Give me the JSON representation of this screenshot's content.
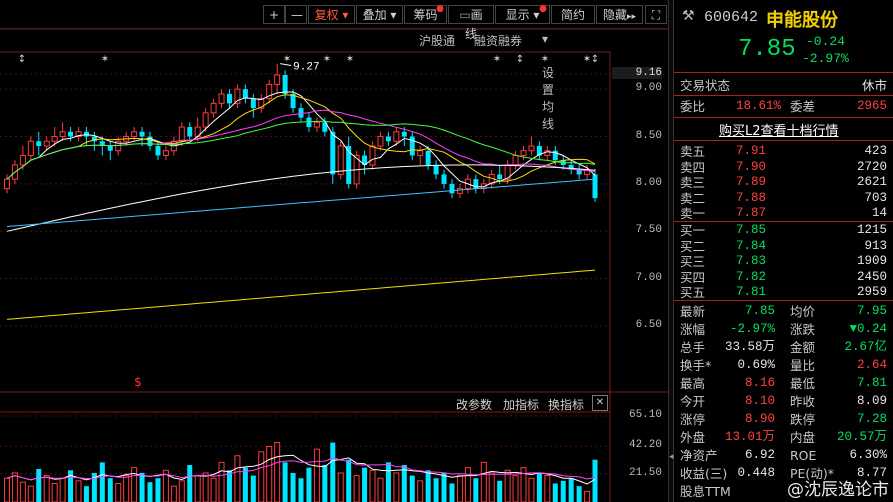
{
  "toolbar": {
    "plus": "+",
    "minus": "—",
    "fuquan": "复权",
    "diejia": "叠加",
    "chouma": "筹码",
    "huaxian": "画线",
    "xianshi": "显示",
    "jianyue": "简约",
    "yincang": "隐藏",
    "next": "▸▸",
    "fullscreen": "⛶"
  },
  "subbar": {
    "hgt": "沪股通",
    "rzrq": "融资融券",
    "shezhi": "设置均线"
  },
  "chart_data": {
    "type": "candlestick",
    "price_axis_ticks": [
      "9.16",
      "9.00",
      "8.50",
      "8.00",
      "7.50",
      "7.00",
      "6.50"
    ],
    "volume_axis_ticks": [
      "65.10",
      "42.20",
      "21.50"
    ],
    "high_label": "9.27",
    "dollar_marker": "$",
    "candles": [
      [
        7.95,
        8.05,
        7.9,
        8.1
      ],
      [
        8.05,
        8.2,
        8.0,
        8.25
      ],
      [
        8.2,
        8.3,
        8.15,
        8.4
      ],
      [
        8.3,
        8.45,
        8.25,
        8.5
      ],
      [
        8.45,
        8.4,
        8.3,
        8.55
      ],
      [
        8.4,
        8.45,
        8.35,
        8.5
      ],
      [
        8.45,
        8.5,
        8.4,
        8.6
      ],
      [
        8.5,
        8.55,
        8.45,
        8.65
      ],
      [
        8.55,
        8.5,
        8.45,
        8.6
      ],
      [
        8.5,
        8.55,
        8.45,
        8.6
      ],
      [
        8.55,
        8.5,
        8.4,
        8.6
      ],
      [
        8.5,
        8.45,
        8.35,
        8.55
      ],
      [
        8.45,
        8.4,
        8.3,
        8.5
      ],
      [
        8.4,
        8.35,
        8.25,
        8.45
      ],
      [
        8.35,
        8.45,
        8.3,
        8.5
      ],
      [
        8.45,
        8.5,
        8.4,
        8.55
      ],
      [
        8.5,
        8.55,
        8.45,
        8.6
      ],
      [
        8.55,
        8.5,
        8.4,
        8.6
      ],
      [
        8.5,
        8.4,
        8.35,
        8.55
      ],
      [
        8.4,
        8.3,
        8.25,
        8.45
      ],
      [
        8.3,
        8.35,
        8.25,
        8.4
      ],
      [
        8.35,
        8.45,
        8.3,
        8.5
      ],
      [
        8.45,
        8.6,
        8.4,
        8.65
      ],
      [
        8.6,
        8.5,
        8.45,
        8.65
      ],
      [
        8.5,
        8.6,
        8.45,
        8.7
      ],
      [
        8.6,
        8.75,
        8.55,
        8.8
      ],
      [
        8.75,
        8.85,
        8.7,
        8.9
      ],
      [
        8.85,
        8.95,
        8.8,
        9.0
      ],
      [
        8.95,
        8.85,
        8.8,
        9.0
      ],
      [
        8.85,
        9.0,
        8.8,
        9.05
      ],
      [
        9.0,
        8.9,
        8.85,
        9.05
      ],
      [
        8.9,
        8.8,
        8.7,
        8.95
      ],
      [
        8.8,
        8.9,
        8.75,
        8.95
      ],
      [
        8.9,
        9.05,
        8.85,
        9.1
      ],
      [
        9.05,
        9.15,
        8.95,
        9.27
      ],
      [
        9.15,
        8.95,
        8.9,
        9.2
      ],
      [
        8.95,
        8.8,
        8.75,
        9.0
      ],
      [
        8.8,
        8.7,
        8.65,
        8.85
      ],
      [
        8.7,
        8.6,
        8.55,
        8.75
      ],
      [
        8.6,
        8.65,
        8.55,
        8.7
      ],
      [
        8.65,
        8.55,
        8.5,
        8.7
      ],
      [
        8.55,
        8.1,
        8.0,
        8.6
      ],
      [
        8.1,
        8.4,
        8.05,
        8.45
      ],
      [
        8.4,
        8.0,
        7.95,
        8.5
      ],
      [
        8.0,
        8.3,
        7.95,
        8.35
      ],
      [
        8.3,
        8.2,
        8.1,
        8.35
      ],
      [
        8.2,
        8.4,
        8.15,
        8.45
      ],
      [
        8.4,
        8.5,
        8.35,
        8.55
      ],
      [
        8.5,
        8.45,
        8.4,
        8.55
      ],
      [
        8.45,
        8.55,
        8.4,
        8.6
      ],
      [
        8.55,
        8.5,
        8.4,
        8.6
      ],
      [
        8.5,
        8.3,
        8.25,
        8.55
      ],
      [
        8.3,
        8.35,
        8.2,
        8.4
      ],
      [
        8.35,
        8.2,
        8.15,
        8.4
      ],
      [
        8.2,
        8.1,
        8.05,
        8.25
      ],
      [
        8.1,
        8.0,
        7.95,
        8.15
      ],
      [
        8.0,
        7.9,
        7.85,
        8.05
      ],
      [
        7.9,
        7.95,
        7.85,
        8.0
      ],
      [
        7.95,
        8.05,
        7.9,
        8.1
      ],
      [
        8.05,
        7.95,
        7.9,
        8.1
      ],
      [
        7.95,
        8.0,
        7.9,
        8.05
      ],
      [
        8.0,
        8.1,
        7.95,
        8.15
      ],
      [
        8.1,
        8.05,
        8.0,
        8.2
      ],
      [
        8.05,
        8.2,
        8.0,
        8.25
      ],
      [
        8.2,
        8.3,
        8.15,
        8.35
      ],
      [
        8.3,
        8.35,
        8.25,
        8.4
      ],
      [
        8.35,
        8.4,
        8.3,
        8.5
      ],
      [
        8.4,
        8.3,
        8.25,
        8.45
      ],
      [
        8.3,
        8.35,
        8.25,
        8.4
      ],
      [
        8.35,
        8.25,
        8.2,
        8.4
      ],
      [
        8.25,
        8.2,
        8.15,
        8.3
      ],
      [
        8.2,
        8.15,
        8.1,
        8.25
      ],
      [
        8.15,
        8.1,
        8.05,
        8.2
      ],
      [
        8.1,
        8.15,
        8.05,
        8.2
      ],
      [
        8.1,
        7.85,
        7.81,
        8.16
      ]
    ],
    "volumes": [
      18,
      22,
      15,
      12,
      25,
      20,
      14,
      18,
      24,
      16,
      12,
      22,
      30,
      18,
      14,
      20,
      26,
      22,
      15,
      18,
      24,
      12,
      16,
      28,
      20,
      22,
      18,
      30,
      24,
      35,
      26,
      20,
      38,
      42,
      45,
      30,
      22,
      18,
      26,
      40,
      28,
      45,
      22,
      32,
      20,
      26,
      24,
      18,
      30,
      22,
      28,
      20,
      16,
      24,
      18,
      22,
      14,
      20,
      26,
      18,
      30,
      22,
      16,
      24,
      20,
      26,
      18,
      22,
      20,
      14,
      16,
      18,
      12,
      8,
      32
    ]
  },
  "stock": {
    "code": "600642",
    "name": "申能股份",
    "price": "7.85",
    "change": "-0.24",
    "change_pct": "-2.97%"
  },
  "panel": {
    "status_label": "交易状态",
    "status_value": "休市",
    "weibi_label": "委比",
    "weibi_value": "18.61%",
    "weicha_label": "委差",
    "weicha_value": "2965",
    "l2_link": "购买L2查看十档行情",
    "asks": [
      {
        "label": "卖五",
        "price": "7.91",
        "vol": "423"
      },
      {
        "label": "卖四",
        "price": "7.90",
        "vol": "2720"
      },
      {
        "label": "卖三",
        "price": "7.89",
        "vol": "2621"
      },
      {
        "label": "卖二",
        "price": "7.88",
        "vol": "703"
      },
      {
        "label": "卖一",
        "price": "7.87",
        "vol": "14"
      }
    ],
    "bids": [
      {
        "label": "买一",
        "price": "7.85",
        "vol": "1215"
      },
      {
        "label": "买二",
        "price": "7.84",
        "vol": "913"
      },
      {
        "label": "买三",
        "price": "7.83",
        "vol": "1909"
      },
      {
        "label": "买四",
        "price": "7.82",
        "vol": "2450"
      },
      {
        "label": "买五",
        "price": "7.81",
        "vol": "2959"
      }
    ],
    "stats": [
      {
        "l1": "最新",
        "v1": "7.85",
        "c1": "green",
        "l2": "均价",
        "v2": "7.95",
        "c2": "green"
      },
      {
        "l1": "涨幅",
        "v1": "-2.97%",
        "c1": "green",
        "l2": "涨跌",
        "v2": "▼0.24",
        "c2": "green"
      },
      {
        "l1": "总手",
        "v1": "33.58万",
        "c1": "white",
        "l2": "金额",
        "v2": "2.67亿",
        "c2": "green"
      },
      {
        "l1": "换手*",
        "v1": "0.69%",
        "c1": "white",
        "l2": "量比",
        "v2": "2.64",
        "c2": "red"
      },
      {
        "l1": "最高",
        "v1": "8.16",
        "c1": "red",
        "l2": "最低",
        "v2": "7.81",
        "c2": "green"
      },
      {
        "l1": "今开",
        "v1": "8.10",
        "c1": "red",
        "l2": "昨收",
        "v2": "8.09",
        "c2": "white"
      },
      {
        "l1": "涨停",
        "v1": "8.90",
        "c1": "red",
        "l2": "跌停",
        "v2": "7.28",
        "c2": "green"
      },
      {
        "l1": "外盘",
        "v1": "13.01万",
        "c1": "red",
        "l2": "内盘",
        "v2": "20.57万",
        "c2": "green"
      },
      {
        "l1": "净资产",
        "v1": "6.92",
        "c1": "white",
        "l2": "ROE",
        "v2": "6.30%",
        "c2": "white"
      },
      {
        "l1": "收益(三)",
        "v1": "0.448",
        "c1": "white",
        "l2": "PE(动)*",
        "v2": "8.77",
        "c2": "white"
      },
      {
        "l1": "股息TTM",
        "v1": "",
        "c1": "white",
        "l2": "",
        "v2": "",
        "c2": "white"
      }
    ]
  },
  "volume_bar": {
    "gaicanshu": "改参数",
    "jiazhibiao": "加指标",
    "huanzhibiao": "换指标",
    "close": "✕"
  },
  "watermark": "@沈辰逸论市",
  "colors": {
    "up": "#ff3c3c",
    "down": "#00e5ff",
    "bg": "#000000",
    "grid": "#7a1a1a"
  }
}
